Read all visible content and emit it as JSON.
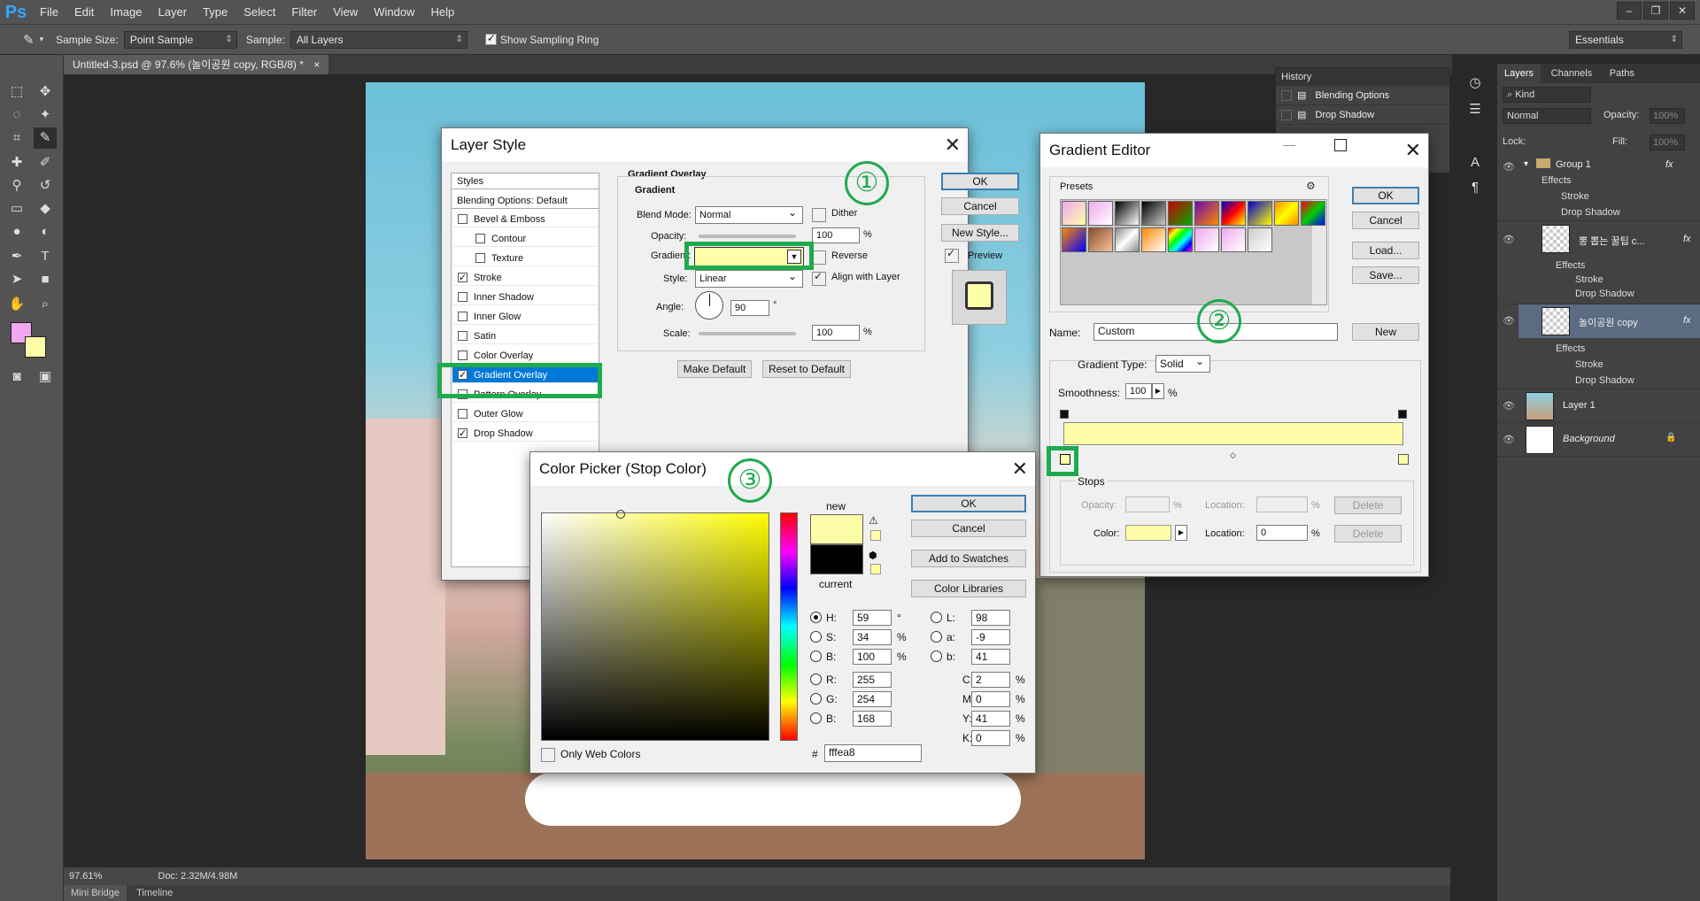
{
  "app": {
    "logo": "Ps",
    "menus": [
      "File",
      "Edit",
      "Image",
      "Layer",
      "Type",
      "Select",
      "Filter",
      "View",
      "Window",
      "Help"
    ]
  },
  "options": {
    "sample_size_label": "Sample Size:",
    "sample_size_value": "Point Sample",
    "sample_label": "Sample:",
    "sample_value": "All Layers",
    "sampling_ring_label": "Show Sampling Ring",
    "workspace": "Essentials"
  },
  "document": {
    "tab_title": "Untitled-3.psd @ 97.6% (놀이공원 copy, RGB/8) *"
  },
  "status": {
    "zoom": "97.61%",
    "doc": "Doc: 2.32M/4.98M"
  },
  "bottom_tabs": [
    "Mini Bridge",
    "Timeline"
  ],
  "history": {
    "title": "History",
    "items": [
      "Blending Options",
      "Drop Shadow"
    ]
  },
  "layers": {
    "tabs": [
      "Layers",
      "Channels",
      "Paths"
    ],
    "kind": "Kind",
    "blend": "Normal",
    "opacity_label": "Opacity:",
    "opacity": "100%",
    "lock_label": "Lock:",
    "fill_label": "Fill:",
    "fill": "100%",
    "rows": [
      {
        "name": "Group 1",
        "fx": "fx",
        "effects": "Effects",
        "subs": [
          "Stroke",
          "Drop Shadow"
        ]
      },
      {
        "name": "뽕 뽑는 꿀팁 c...",
        "fx": "fx",
        "effects": "Effects",
        "subs": [
          "Stroke",
          "Drop Shadow"
        ]
      },
      {
        "name": "놀이공원 copy",
        "fx": "fx",
        "effects": "Effects",
        "subs": [
          "Stroke",
          "Drop Shadow"
        ]
      },
      {
        "name": "Layer 1"
      },
      {
        "name": "Background"
      }
    ]
  },
  "layer_style": {
    "title": "Layer Style",
    "styles_header": "Styles",
    "blending": "Blending Options: Default",
    "items": [
      {
        "label": "Bevel & Emboss",
        "checked": false
      },
      {
        "label": "Contour",
        "checked": false
      },
      {
        "label": "Texture",
        "checked": false
      },
      {
        "label": "Stroke",
        "checked": true
      },
      {
        "label": "Inner Shadow",
        "checked": false
      },
      {
        "label": "Inner Glow",
        "checked": false
      },
      {
        "label": "Satin",
        "checked": false
      },
      {
        "label": "Color Overlay",
        "checked": false
      },
      {
        "label": "Gradient Overlay",
        "checked": true
      },
      {
        "label": "Pattern Overlay",
        "checked": false
      },
      {
        "label": "Outer Glow",
        "checked": false
      },
      {
        "label": "Drop Shadow",
        "checked": true
      }
    ],
    "section": "Gradient Overlay",
    "sub_section": "Gradient",
    "blend_mode_label": "Blend Mode:",
    "blend_mode": "Normal",
    "dither": "Dither",
    "opacity_label": "Opacity:",
    "opacity": "100",
    "pct": "%",
    "gradient_label": "Gradient:",
    "reverse": "Reverse",
    "style_label": "Style:",
    "style": "Linear",
    "align": "Align with Layer",
    "angle_label": "Angle:",
    "angle": "90",
    "deg": "°",
    "scale_label": "Scale:",
    "scale": "100",
    "make_default": "Make Default",
    "reset_default": "Reset to Default",
    "ok": "OK",
    "cancel": "Cancel",
    "new_style": "New Style...",
    "preview": "Preview"
  },
  "gradient_editor": {
    "title": "Gradient Editor",
    "presets": "Presets",
    "ok": "OK",
    "cancel": "Cancel",
    "load": "Load...",
    "save": "Save...",
    "name_label": "Name:",
    "name": "Custom",
    "new": "New",
    "type_label": "Gradient Type:",
    "type": "Solid",
    "smooth_label": "Smoothness:",
    "smooth": "100",
    "pct": "%",
    "stops": "Stops",
    "opacity_label": "Opacity:",
    "location_label": "Location:",
    "delete": "Delete",
    "color_label": "Color:",
    "location": "0"
  },
  "color_picker": {
    "title": "Color Picker (Stop Color)",
    "ok": "OK",
    "cancel": "Cancel",
    "add_swatches": "Add to Swatches",
    "libraries": "Color Libraries",
    "new": "new",
    "current": "current",
    "H": "59",
    "S": "34",
    "B": "100",
    "R": "255",
    "G": "254",
    "Bb": "168",
    "L": "98",
    "a": "-9",
    "b": "41",
    "C": "2",
    "M": "0",
    "Y": "41",
    "K": "0",
    "hex": "fffea8",
    "hash": "#",
    "web": "Only Web Colors",
    "lbl_H": "H:",
    "lbl_S": "S:",
    "lbl_B": "B:",
    "lbl_R": "R:",
    "lbl_G": "G:",
    "lbl_Bb": "B:",
    "lbl_L": "L:",
    "lbl_a": "a:",
    "lbl_b": "b:",
    "lbl_C": "C:",
    "lbl_M": "M:",
    "lbl_Y": "Y:",
    "lbl_K": "K:",
    "deg": "°",
    "pct": "%"
  },
  "annotations": [
    "①",
    "②",
    "③"
  ],
  "colors": {
    "stop_color": "#fffea8",
    "accent": "#1faa4e",
    "selected": "#0078d7"
  }
}
